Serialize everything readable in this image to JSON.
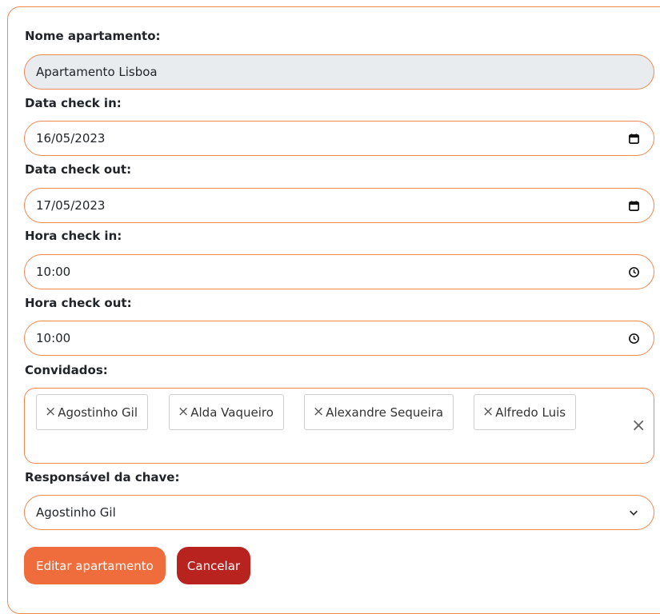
{
  "form": {
    "name_label": "Nome apartamento:",
    "name_value": "Apartamento Lisboa",
    "checkin_date_label": "Data check in:",
    "checkin_date_value": "16/05/2023",
    "checkout_date_label": "Data check out:",
    "checkout_date_value": "17/05/2023",
    "checkin_time_label": "Hora check in:",
    "checkin_time_value": "10:00",
    "checkout_time_label": "Hora check out:",
    "checkout_time_value": "10:00",
    "guests_label": "Convidados:",
    "guests": [
      "Agostinho Gil",
      "Alda Vaqueiro",
      "Alexandre Sequeira",
      "Alfredo Luis"
    ],
    "chip_remove_symbol": "×",
    "clear_symbol": "×",
    "key_holder_label": "Responsável da chave:",
    "key_holder_value": "Agostinho Gil",
    "edit_button": "Editar apartamento",
    "cancel_button": "Cancelar"
  },
  "icons": {
    "date": "calendar-icon",
    "time": "clock-icon",
    "select": "chevron-down-icon"
  },
  "colors": {
    "accent_border": "#f0874f",
    "edit_button": "#ef6c3c",
    "cancel_button": "#b8221f",
    "readonly_bg": "#e9ecef"
  }
}
